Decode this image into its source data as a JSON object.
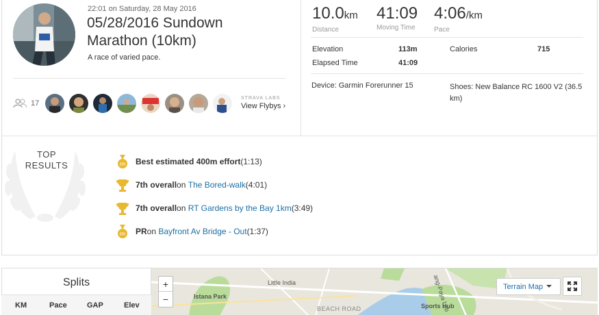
{
  "activity": {
    "datetime": "22:01 on Saturday, 28 May 2016",
    "title": "05/28/2016 Sundown Marathon (10km)",
    "description": "A race of varied pace.",
    "kudos_count": "17",
    "flyby_small": "STRAVA LABS",
    "flyby_link": "View Flybys ›"
  },
  "stats": {
    "distance": {
      "value": "10.0",
      "unit": "km",
      "label": "Distance"
    },
    "moving_time": {
      "value": "41:09",
      "label": "Moving Time"
    },
    "pace": {
      "value": "4:06",
      "unit": "/km",
      "label": "Pace"
    },
    "elevation": {
      "label": "Elevation",
      "value": "113m"
    },
    "calories": {
      "label": "Calories",
      "value": "715"
    },
    "elapsed": {
      "label": "Elapsed Time",
      "value": "41:09"
    },
    "device": "Device: Garmin Forerunner 15",
    "shoes": "Shoes: New Balance RC 1600 V2 (36.5 km)"
  },
  "top_results": {
    "heading_line1": "TOP",
    "heading_line2": "RESULTS",
    "items": [
      {
        "icon": "pr-medal-icon",
        "strong": "Best estimated 400m effort",
        "mid": "",
        "link": "",
        "tail": " (1:13)"
      },
      {
        "icon": "trophy-icon",
        "strong": "7th overall",
        "mid": " on ",
        "link": "The Bored-walk",
        "tail": " (4:01)"
      },
      {
        "icon": "trophy-icon",
        "strong": "7th overall",
        "mid": " on ",
        "link": "RT Gardens by the Bay 1km",
        "tail": " (3:49)"
      },
      {
        "icon": "pr-medal-icon",
        "strong": "PR",
        "mid": " on ",
        "link": "Bayfront Av Bridge - Out",
        "tail": " (1:37)"
      }
    ]
  },
  "splits": {
    "title": "Splits",
    "columns": [
      "KM",
      "Pace",
      "GAP",
      "Elev"
    ]
  },
  "map": {
    "labels": [
      "Little India",
      "Istana Park",
      "BEACH ROAD",
      "Sports Hub",
      "ang-Paya Leb"
    ],
    "zoom_in": "+",
    "zoom_out": "−",
    "terrain_label": "Terrain Map"
  },
  "colors": {
    "link": "#1d6fa5",
    "gold": "#e8b92f",
    "park": "#b9dc9a",
    "water": "#a9cde8"
  }
}
